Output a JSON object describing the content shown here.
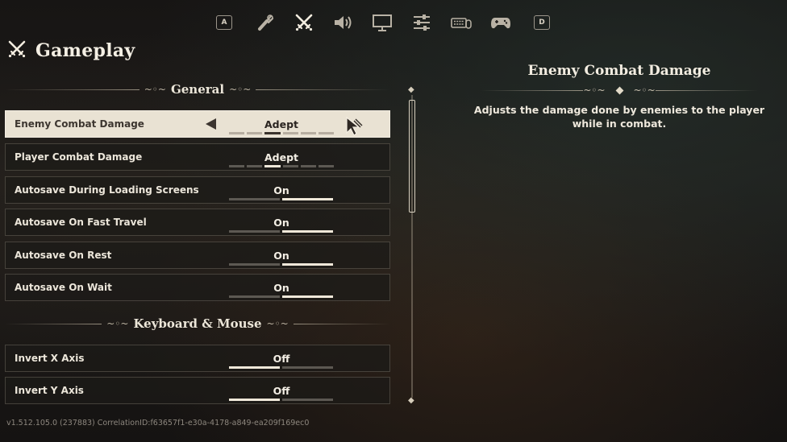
{
  "nav": {
    "left_key": "A",
    "right_key": "D",
    "tabs": [
      {
        "icon": "torch-icon"
      },
      {
        "icon": "crossed-swords-icon",
        "active": true
      },
      {
        "icon": "speaker-icon"
      },
      {
        "icon": "monitor-icon"
      },
      {
        "icon": "sliders-icon"
      },
      {
        "icon": "keyboard-mouse-icon"
      },
      {
        "icon": "gamepad-icon"
      }
    ]
  },
  "page": {
    "title": "Gameplay",
    "title_icon": "crossed-swords-icon"
  },
  "sections": {
    "general": "General",
    "keyboard_mouse": "Keyboard & Mouse"
  },
  "rows": [
    {
      "label": "Enemy Combat Damage",
      "value": "Adept",
      "type": "slider",
      "level": 3,
      "steps": 6,
      "selected": true
    },
    {
      "label": "Player Combat Damage",
      "value": "Adept",
      "type": "slider",
      "level": 3,
      "steps": 6
    },
    {
      "label": "Autosave During Loading Screens",
      "value": "On",
      "type": "toggle",
      "on": true
    },
    {
      "label": "Autosave On Fast Travel",
      "value": "On",
      "type": "toggle",
      "on": true
    },
    {
      "label": "Autosave On Rest",
      "value": "On",
      "type": "toggle",
      "on": true
    },
    {
      "label": "Autosave On Wait",
      "value": "On",
      "type": "toggle",
      "on": true
    },
    {
      "label": "Invert X Axis",
      "value": "Off",
      "type": "toggle",
      "on": false
    },
    {
      "label": "Invert Y Axis",
      "value": "Off",
      "type": "toggle",
      "on": false
    }
  ],
  "description": {
    "title": "Enemy Combat Damage",
    "text": "Adjusts the damage done by enemies to the player while in combat."
  },
  "footer": {
    "version": "v1.512.105.0 (237883) CorrelationID:f63657f1-e30a-4178-a849-ea209f169ec0"
  },
  "colors": {
    "accent": "#e9e2d3",
    "row_bg": "#1c1a18",
    "text": "#ece6da"
  }
}
